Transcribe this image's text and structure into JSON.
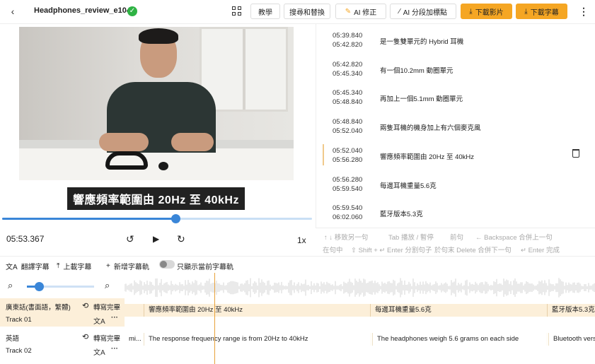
{
  "header": {
    "file_name": "Headphones_review_e104",
    "buttons": {
      "tutorial": "教學",
      "search_replace": "搜尋和替換",
      "ai_fix": "AI 修正",
      "ai_segment": "AI 分段加標點",
      "download_video": "下載影片",
      "download_subs": "下載字幕"
    }
  },
  "player": {
    "subtitle": "響應頻率範圍由 20Hz 至 40kHz",
    "current_time": "05:53.367",
    "speed": "1x",
    "progress": 0.56
  },
  "subtitle_list": [
    {
      "start": "05:39.840",
      "end": "05:42.820",
      "text": "是一隻雙單元的 Hybrid 耳機"
    },
    {
      "start": "05:42.820",
      "end": "05:45.340",
      "text": "有一個10.2mm 動圈單元"
    },
    {
      "start": "05:45.340",
      "end": "05:48.840",
      "text": "再加上一個5.1mm 動圈單元"
    },
    {
      "start": "05:48.840",
      "end": "05:52.040",
      "text": "兩隻耳機的機身加上有六個麥克風"
    },
    {
      "start": "05:52.040",
      "end": "05:56.280",
      "text": "響應頻率範圍由 20Hz 至 40kHz",
      "active": true
    },
    {
      "start": "05:56.280",
      "end": "05:59.540",
      "text": "每邊耳機重量5.6克"
    },
    {
      "start": "05:59.540",
      "end": "06:02.060",
      "text": "藍牙版本5.3克"
    }
  ],
  "hints": {
    "h1": "↑ ↓ 移致另一句",
    "h2": "Tab 播放 / 暫停",
    "h3": "前句",
    "h4": "← Backspace 合併上一句",
    "h5": "在句中",
    "h6": "⇧ Shift + ↵ Enter 分割句子",
    "h7": "於句末 Delete 合併下一句",
    "h8": "↵ Enter 完成"
  },
  "toolbar": {
    "translate": "翻譯字幕",
    "upload": "上載字幕",
    "add_track": "新增字幕軌",
    "only_current": "只顯示當前字幕軌"
  },
  "tracks": [
    {
      "language": "廣東話(書面語，繁體)",
      "status": "轉寫完畢",
      "name": "Track 01",
      "segments": [
        "",
        "響應頻率範圍由 20Hz 至 40kHz",
        "每邊耳機重量5.6克",
        "藍牙版本5.3克"
      ]
    },
    {
      "language": "英語",
      "status": "轉寫完畢",
      "name": "Track 02",
      "segments": [
        "mi...",
        "The response frequency range is from 20Hz to 40kHz",
        "The headphones weigh 5.6 grams on each side",
        "Bluetooth vers"
      ]
    }
  ],
  "zoom": {
    "level": 0.18
  }
}
